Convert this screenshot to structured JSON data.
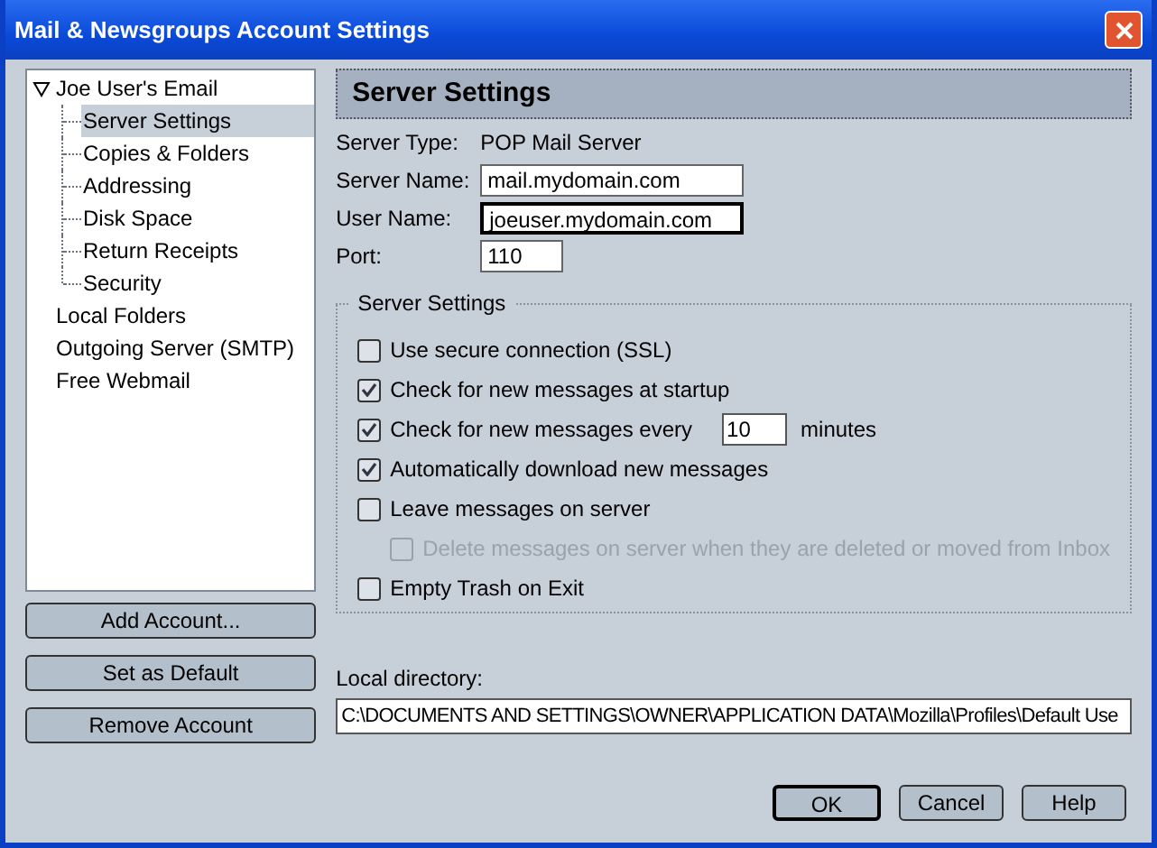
{
  "window": {
    "title": "Mail & Newsgroups Account Settings"
  },
  "tree": [
    {
      "label": "Joe User's Email",
      "expanded": true,
      "selected": false,
      "children": [
        {
          "label": "Server Settings",
          "selected": true
        },
        {
          "label": "Copies & Folders",
          "selected": false
        },
        {
          "label": "Addressing",
          "selected": false
        },
        {
          "label": "Disk Space",
          "selected": false
        },
        {
          "label": "Return Receipts",
          "selected": false
        },
        {
          "label": "Security",
          "selected": false
        }
      ]
    },
    {
      "label": "Local Folders",
      "selected": false
    },
    {
      "label": "Outgoing Server (SMTP)",
      "selected": false
    },
    {
      "label": "Free Webmail",
      "selected": false
    }
  ],
  "account_buttons": [
    "Add Account...",
    "Set as Default",
    "Remove Account"
  ],
  "page_title": "Server Settings",
  "fields": [
    {
      "kind": "static",
      "label": "Server Type:",
      "value": "POP Mail Server"
    },
    {
      "kind": "input",
      "label": "Server Name:",
      "value": "mail.mydomain.com",
      "focused": false
    },
    {
      "kind": "input",
      "label": "User Name:",
      "value": "joeuser.mydomain.com",
      "focused": true
    },
    {
      "kind": "short_input",
      "label": "Port:",
      "value": "110",
      "focused": false
    }
  ],
  "group": {
    "title": "Server Settings",
    "options": [
      {
        "kind": "checkbox",
        "label": "Use secure connection (SSL)",
        "checked": false,
        "disabled": false
      },
      {
        "kind": "checkbox",
        "label": "Check for new messages at startup",
        "checked": true,
        "disabled": false
      },
      {
        "kind": "interval",
        "label": "Check for new messages every",
        "checked": true,
        "disabled": false,
        "value": "10",
        "unit": "minutes"
      },
      {
        "kind": "checkbox",
        "label": "Automatically download new messages",
        "checked": true,
        "disabled": false
      },
      {
        "kind": "checkbox",
        "label": "Leave messages on server",
        "checked": false,
        "disabled": false,
        "children": [
          {
            "kind": "checkbox",
            "label": "Delete messages on server when they are deleted or moved from Inbox",
            "checked": false,
            "disabled": true
          }
        ]
      },
      {
        "kind": "checkbox",
        "label": "Empty Trash on Exit",
        "checked": false,
        "disabled": false
      }
    ]
  },
  "local_directory": {
    "label": "Local directory:",
    "value": "C:\\DOCUMENTS AND SETTINGS\\OWNER\\APPLICATION DATA\\Mozilla\\Profiles\\Default Use"
  },
  "dialog_buttons": [
    {
      "label": "OK",
      "default": true
    },
    {
      "label": "Cancel",
      "default": false
    },
    {
      "label": "Help",
      "default": false
    }
  ]
}
